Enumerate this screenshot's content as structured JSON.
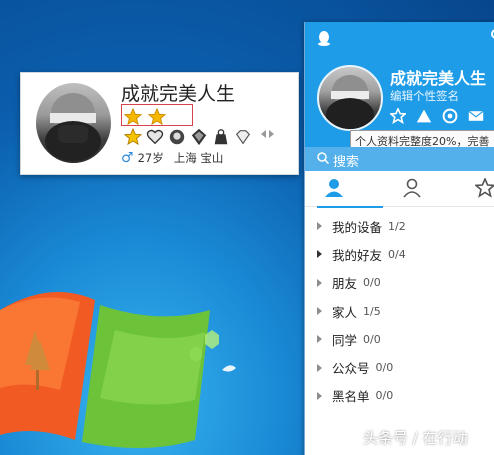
{
  "hover_card": {
    "name": "成就完美人生",
    "level_stars": [
      "star-icon",
      "star-icon"
    ],
    "medals": [
      "crown-star-icon",
      "heart-medal-icon",
      "skull-medal-icon",
      "gem-medal-icon",
      "bag-medal-icon",
      "diamond-icon"
    ],
    "gender_symbol": "♂",
    "age": "27岁",
    "location": "上海 宝山"
  },
  "panel": {
    "name": "成就完美人生",
    "signature": "编辑个性签名",
    "tooltip": "个人资料完整度20%，完善",
    "search_placeholder": "搜索",
    "groups": [
      {
        "label": "我的设备",
        "count": "1/2",
        "expanded": false
      },
      {
        "label": "我的好友",
        "count": "0/4",
        "expanded": false
      },
      {
        "label": "朋友",
        "count": "0/0",
        "expanded": false
      },
      {
        "label": "家人",
        "count": "1/5",
        "expanded": false
      },
      {
        "label": "同学",
        "count": "0/0",
        "expanded": false
      },
      {
        "label": "公众号",
        "count": "0/0",
        "expanded": false
      },
      {
        "label": "黑名单",
        "count": "0/0",
        "expanded": false
      }
    ]
  },
  "watermark": "头条号 / 在行动",
  "colors": {
    "accent": "#1e9ce7",
    "search_bar": "#54b0ea",
    "level_box_border": "#d9434b",
    "star_gold": "#f5b800"
  }
}
